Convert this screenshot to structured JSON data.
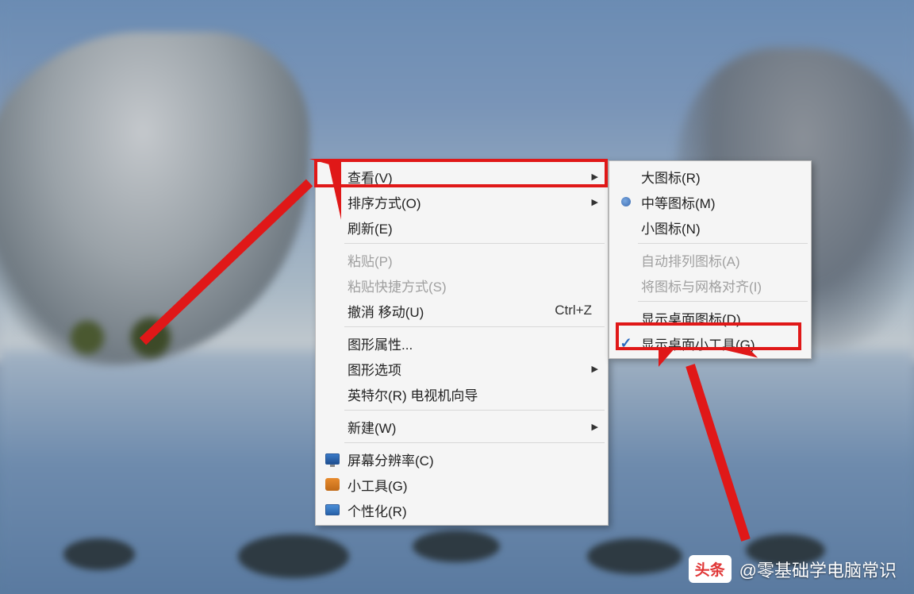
{
  "context_menu": {
    "items": [
      {
        "label": "查看(V)",
        "submenu": true,
        "highlighted": true
      },
      {
        "label": "排序方式(O)",
        "submenu": true
      },
      {
        "label": "刷新(E)"
      },
      {
        "sep": true
      },
      {
        "label": "粘贴(P)",
        "disabled": true
      },
      {
        "label": "粘贴快捷方式(S)",
        "disabled": true
      },
      {
        "label": "撤消 移动(U)",
        "shortcut": "Ctrl+Z"
      },
      {
        "sep": true
      },
      {
        "label": "图形属性..."
      },
      {
        "label": "图形选项",
        "submenu": true
      },
      {
        "label": "英特尔(R) 电视机向导"
      },
      {
        "sep": true
      },
      {
        "label": "新建(W)",
        "submenu": true
      },
      {
        "sep": true
      },
      {
        "label": "屏幕分辨率(C)",
        "icon": "monitor"
      },
      {
        "label": "小工具(G)",
        "icon": "gadget"
      },
      {
        "label": "个性化(R)",
        "icon": "personalize"
      }
    ]
  },
  "view_submenu": {
    "items": [
      {
        "label": "大图标(R)"
      },
      {
        "label": "中等图标(M)",
        "radio": true
      },
      {
        "label": "小图标(N)"
      },
      {
        "sep": true
      },
      {
        "label": "自动排列图标(A)",
        "disabled": true
      },
      {
        "label": "将图标与网格对齐(I)",
        "disabled": true
      },
      {
        "sep": true
      },
      {
        "label": "显示桌面图标(D)",
        "highlighted": true
      },
      {
        "label": "显示桌面小工具(G)",
        "check": true
      }
    ]
  },
  "watermark": {
    "logo": "头条",
    "text": "@零基础学电脑常识"
  },
  "annotation_color": "#e01818"
}
